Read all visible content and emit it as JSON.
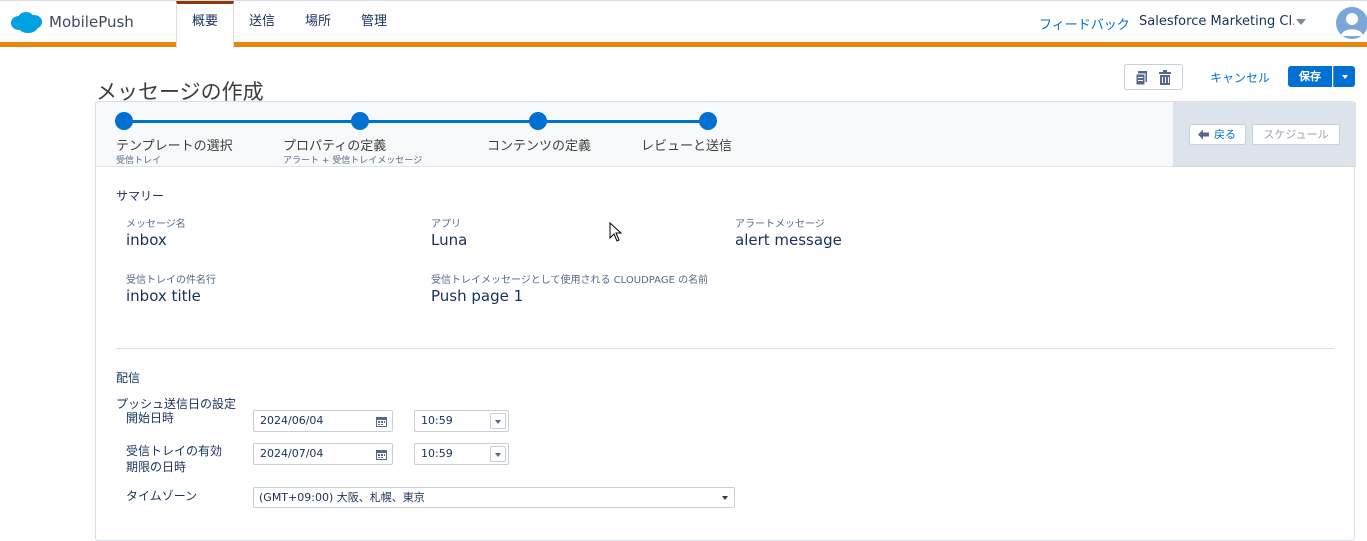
{
  "app": {
    "name": "MobilePush"
  },
  "nav": {
    "tabs": [
      {
        "label": "概要",
        "active": true
      },
      {
        "label": "送信",
        "active": false
      },
      {
        "label": "場所",
        "active": false
      },
      {
        "label": "管理",
        "active": false
      }
    ],
    "feedback": "フィードバック",
    "org": "Salesforce Marketing Cl..."
  },
  "header": {
    "title": "メッセージの作成",
    "cancel": "キャンセル",
    "save": "保存"
  },
  "stepper": {
    "steps": [
      {
        "label": "テンプレートの選択",
        "sub": "受信トレイ"
      },
      {
        "label": "プロパティの定義",
        "sub": "アラート + 受信トレイメッセージ"
      },
      {
        "label": "コンテンツの定義",
        "sub": ""
      },
      {
        "label": "レビューと送信",
        "sub": ""
      }
    ],
    "back": "戻る",
    "schedule": "スケジュール"
  },
  "summary": {
    "title": "サマリー",
    "fields": [
      {
        "label": "メッセージ名",
        "value": "inbox"
      },
      {
        "label": "アプリ",
        "value": "Luna"
      },
      {
        "label": "アラートメッセージ",
        "value": "alert message"
      },
      {
        "label": "受信トレイの件名行",
        "value": "inbox title"
      },
      {
        "label": "受信トレイメッセージとして使用される CLOUDPAGE の名前",
        "value": "Push page 1"
      }
    ]
  },
  "delivery": {
    "title": "配信",
    "push_send_label": "プッシュ送信日の設定",
    "start_label": "開始日時",
    "start_date": "2024/06/04",
    "start_time": "10:59",
    "expiry_label_1": "受信トレイの有効",
    "expiry_label_2": "期限の日時",
    "expiry_date": "2024/07/04",
    "expiry_time": "10:59",
    "timezone_label": "タイムゾーン",
    "timezone_value": "(GMT+09:00) 大阪、札幌、東京"
  },
  "colors": {
    "brand_blue": "#0070d2",
    "orange_bar": "#e8870f",
    "logo_blue": "#00a1e0"
  }
}
